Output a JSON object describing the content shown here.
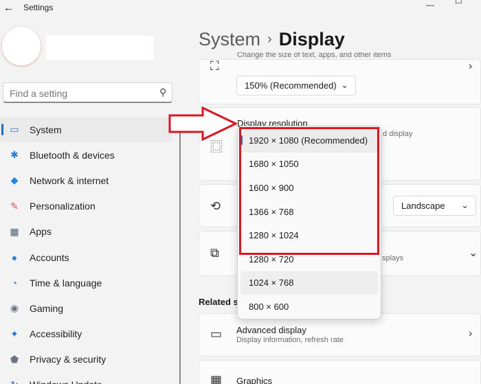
{
  "window": {
    "title": "Settings",
    "back_glyph": "←",
    "min_glyph": "—",
    "max_glyph": "☐"
  },
  "search": {
    "placeholder": "Find a setting"
  },
  "sidebar": {
    "items": [
      {
        "label": "System",
        "icon": "system-monitor-icon",
        "glyph": "▭",
        "color": "#2f6fcf"
      },
      {
        "label": "Bluetooth & devices",
        "icon": "bluetooth-icon",
        "glyph": "✱",
        "color": "#1e7bd6"
      },
      {
        "label": "Network & internet",
        "icon": "wifi-icon",
        "glyph": "◆",
        "color": "#1e88e5"
      },
      {
        "label": "Personalization",
        "icon": "paintbrush-icon",
        "glyph": "✎",
        "color": "#d9534f"
      },
      {
        "label": "Apps",
        "icon": "apps-icon",
        "glyph": "▦",
        "color": "#4b5b6e"
      },
      {
        "label": "Accounts",
        "icon": "person-icon",
        "glyph": "●",
        "color": "#2b86d9"
      },
      {
        "label": "Time & language",
        "icon": "globe-clock-icon",
        "glyph": "◔",
        "color": "#2a7fd4"
      },
      {
        "label": "Gaming",
        "icon": "gamepad-icon",
        "glyph": "◉",
        "color": "#6a7480"
      },
      {
        "label": "Accessibility",
        "icon": "accessibility-icon",
        "glyph": "✦",
        "color": "#1f6fd0"
      },
      {
        "label": "Privacy & security",
        "icon": "shield-icon",
        "glyph": "⬟",
        "color": "#6b7380"
      },
      {
        "label": "Windows Update",
        "icon": "update-icon",
        "glyph": "↻",
        "color": "#1f6fd0"
      }
    ]
  },
  "header": {
    "parent": "System",
    "separator": "›",
    "current": "Display"
  },
  "scale": {
    "description": "Change the size of text, apps, and other items",
    "value": "150% (Recommended)",
    "chevron": "⌄"
  },
  "resolution": {
    "title": "Display resolution",
    "desc_fragment": "d display",
    "options": [
      "1920 × 1080 (Recommended)",
      "1680 × 1050",
      "1600 × 900",
      "1366 × 768",
      "1280 × 1024",
      "1280 × 720",
      "1024 × 768",
      "800 × 600"
    ],
    "selected_index": 0
  },
  "orientation": {
    "value": "Landscape",
    "chevron": "⌄"
  },
  "multiple_displays": {
    "desc_fragment": "splays"
  },
  "related": {
    "heading": "Related se"
  },
  "advanced": {
    "title": "Advanced display",
    "desc": "Display information, refresh rate"
  },
  "graphics": {
    "title": "Graphics"
  },
  "chevron_right": "›",
  "colors": {
    "highlight": "#e0141e",
    "accent": "#1f6fd0"
  }
}
